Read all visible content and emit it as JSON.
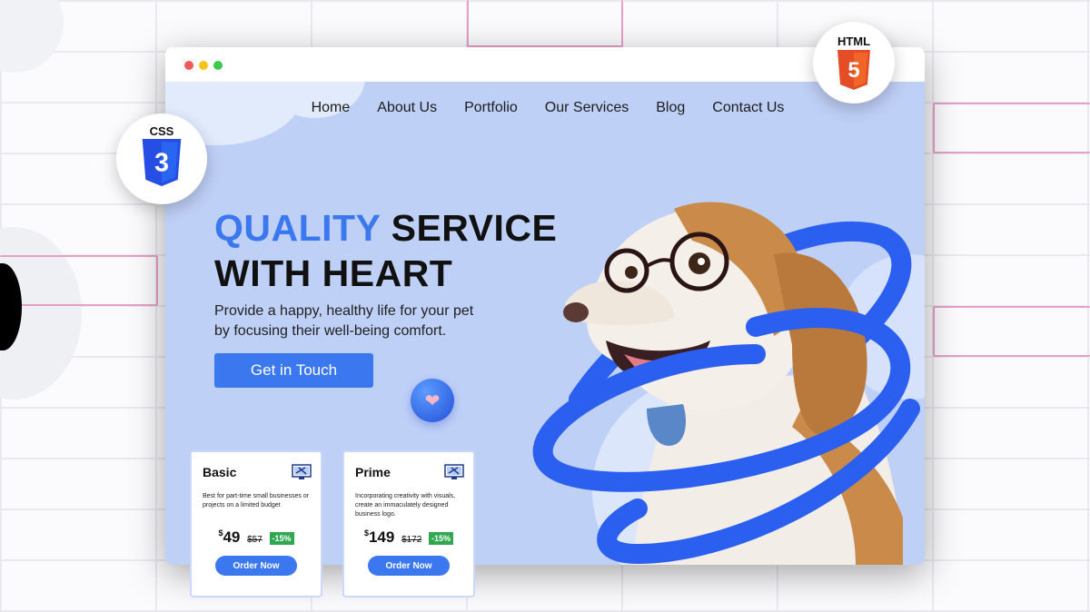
{
  "nav": {
    "items": [
      "Home",
      "About Us",
      "Portfolio",
      "Our Services",
      "Blog",
      "Contact Us"
    ]
  },
  "hero": {
    "title_accent": "QUALITY",
    "title_rest": "SERVICE",
    "title_line2": "WITH HEART",
    "subtitle": "Provide a happy, healthy life for your pet by focusing their well-being comfort.",
    "cta": "Get in Touch"
  },
  "badges": {
    "css": "CSS",
    "css_glyph": "3",
    "html": "HTML",
    "html_glyph": "5"
  },
  "pricing": [
    {
      "name": "Basic",
      "desc": "Best for part-time small businesses or projects on a limited budget",
      "currency": "$",
      "price": "49",
      "old": "$57",
      "discount": "-15%",
      "button": "Order Now"
    },
    {
      "name": "Prime",
      "desc": "Incorporating creativity with visuals, create an immaculately designed business logo.",
      "currency": "$",
      "price": "149",
      "old": "$172",
      "discount": "-15%",
      "button": "Order Now"
    }
  ],
  "colors": {
    "accent": "#3b78f0",
    "hero_bg": "#bfd0f7",
    "discount": "#2fa84f",
    "html5": "#e44d26",
    "css3": "#264de4"
  },
  "icons": [
    "heart-icon",
    "monitor-tools-icon",
    "css3-shield-icon",
    "html5-shield-icon"
  ]
}
